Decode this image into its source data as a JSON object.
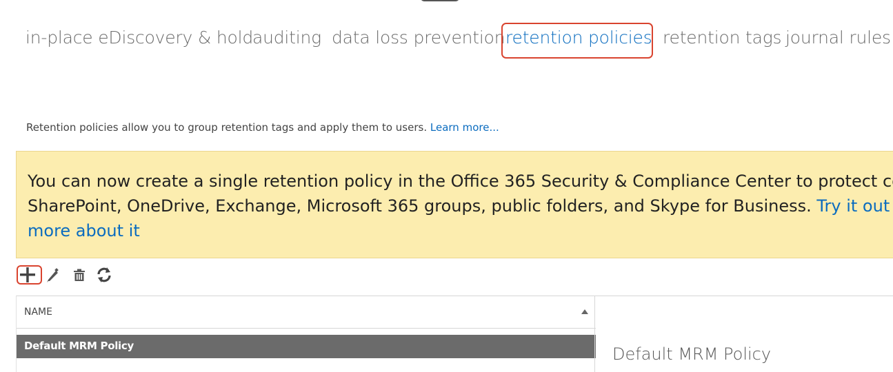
{
  "tabs": [
    {
      "label": "in-place eDiscovery & hold",
      "active": false
    },
    {
      "label": "auditing",
      "active": false
    },
    {
      "label": "data loss prevention",
      "active": false
    },
    {
      "label": "retention policies",
      "active": true
    },
    {
      "label": "retention tags",
      "active": false
    },
    {
      "label": "journal rules",
      "active": false
    }
  ],
  "description": {
    "text": "Retention policies allow you to group retention tags and apply them to users.",
    "link": "Learn more..."
  },
  "banner": {
    "line1": "You can now create a single retention policy in the Office 365 Security & Compliance Center to protect co",
    "line2_text": "SharePoint, OneDrive, Exchange, Microsoft 365 groups, public folders, and Skype for Business.",
    "line2_link": "Try it out no",
    "line3_link": "more about it"
  },
  "toolbar": {
    "buttons": [
      "add-icon",
      "edit-icon",
      "delete-icon",
      "refresh-icon"
    ]
  },
  "list": {
    "column_header": "NAME",
    "rows": [
      {
        "name": "Default MRM Policy",
        "selected": true
      }
    ]
  },
  "detail": {
    "title": "Default MRM Policy"
  },
  "colors": {
    "accent": "#0b6cbf",
    "highlight": "#d9432e",
    "banner_bg": "#fcedaf",
    "selected_row": "#6b6b6b"
  }
}
